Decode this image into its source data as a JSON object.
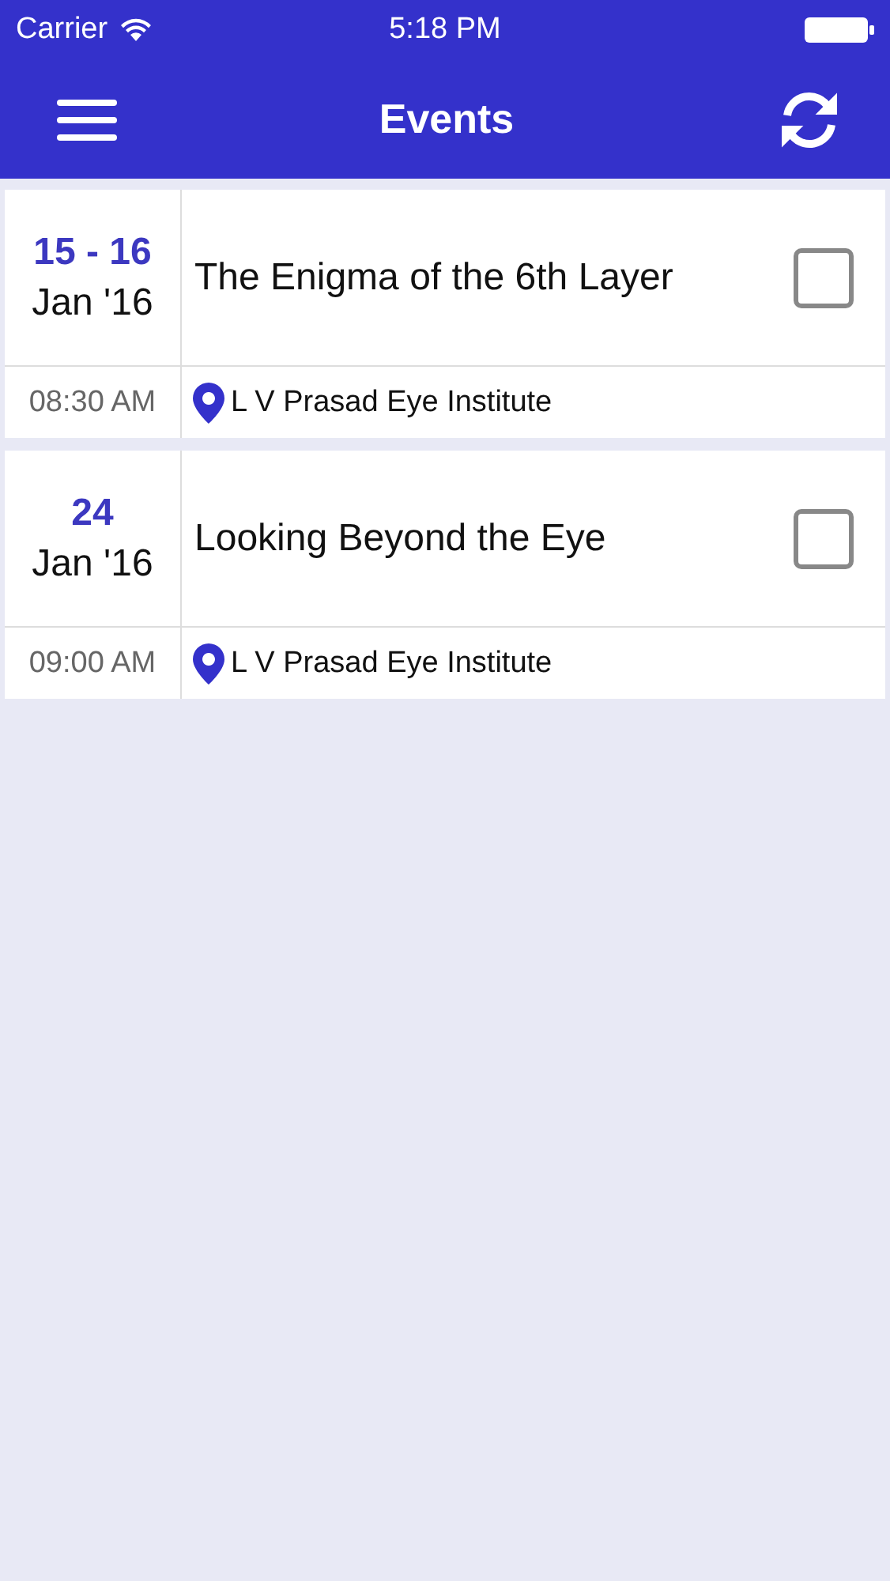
{
  "status_bar": {
    "carrier": "Carrier",
    "time": "5:18 PM"
  },
  "nav_bar": {
    "title": "Events"
  },
  "events": [
    {
      "days": "15 - 16",
      "month": "Jan '16",
      "title": "The Enigma of the 6th Layer",
      "checked": false,
      "time": "08:30 AM",
      "venue": "L V Prasad Eye Institute"
    },
    {
      "days": "24",
      "month": "Jan '16",
      "title": "Looking Beyond the Eye",
      "checked": false,
      "time": "09:00 AM",
      "venue": "L V Prasad Eye Institute"
    }
  ]
}
